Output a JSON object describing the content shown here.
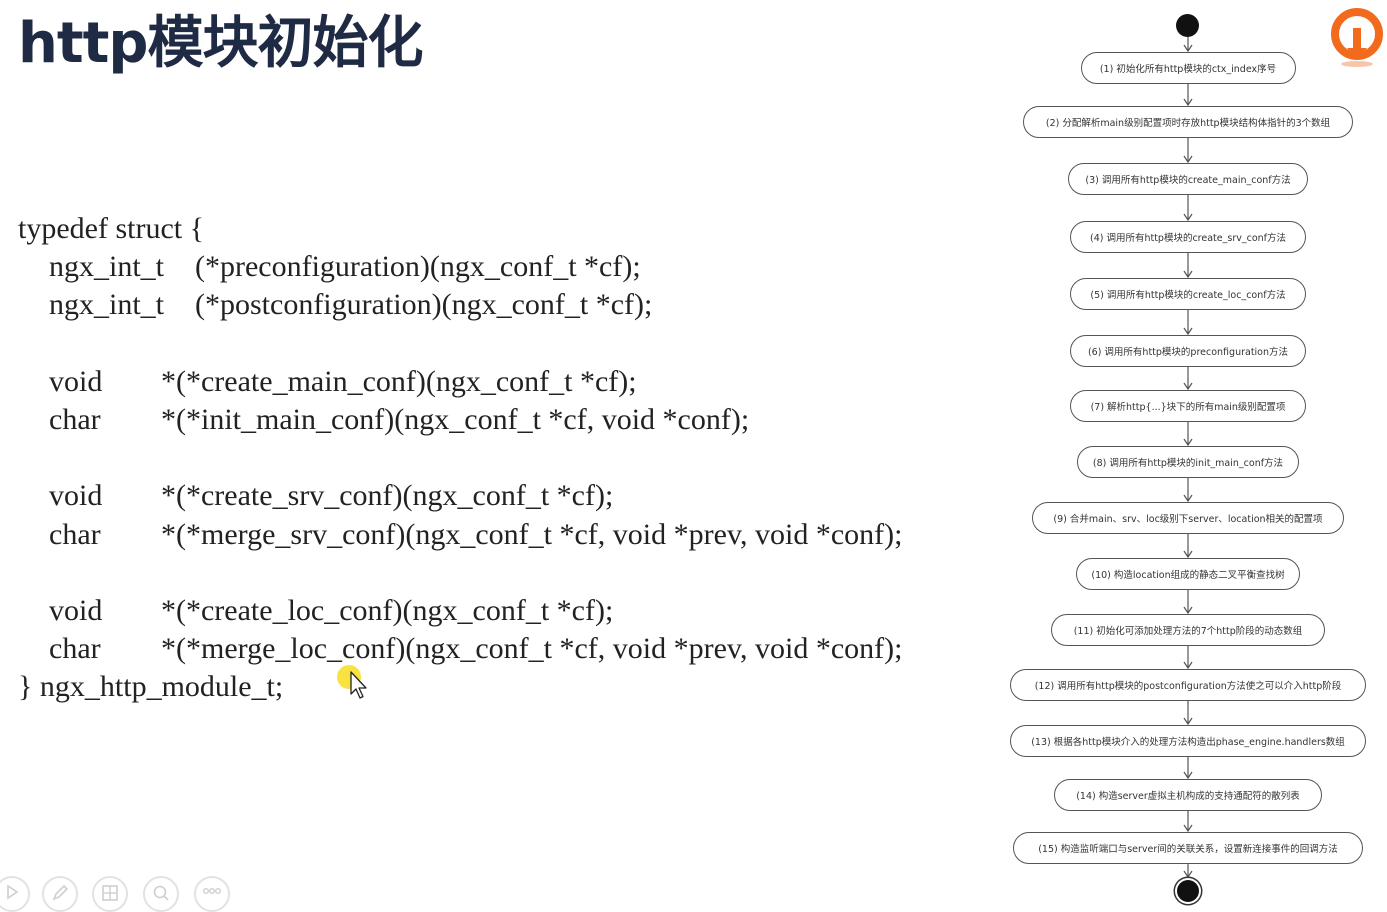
{
  "slide": {
    "title": "http模块初始化"
  },
  "code": {
    "open": "typedef struct {",
    "lines": [
      {
        "type": "ngx_int_t",
        "decl": "(*preconfiguration)(ngx_conf_t *cf);"
      },
      {
        "type": "ngx_int_t",
        "decl": "(*postconfiguration)(ngx_conf_t *cf);"
      },
      {
        "type": "void",
        "decl": "*(*create_main_conf)(ngx_conf_t *cf);"
      },
      {
        "type": "char",
        "decl": "*(*init_main_conf)(ngx_conf_t *cf, void *conf);"
      },
      {
        "type": "void",
        "decl": "*(*create_srv_conf)(ngx_conf_t *cf);"
      },
      {
        "type": "char",
        "decl": "*(*merge_srv_conf)(ngx_conf_t *cf, void *prev, void *conf);"
      },
      {
        "type": "void",
        "decl": "*(*create_loc_conf)(ngx_conf_t *cf);"
      },
      {
        "type": "char",
        "decl": "*(*merge_loc_conf)(ngx_conf_t *cf, void *prev, void *conf);"
      }
    ],
    "close": "} ngx_http_module_t;"
  },
  "flow": {
    "steps": [
      "(1) 初始化所有http模块的ctx_index序号",
      "(2) 分配解析main级别配置项时存放http模块结构体指针的3个数组",
      "(3) 调用所有http模块的create_main_conf方法",
      "(4) 调用所有http模块的create_srv_conf方法",
      "(5) 调用所有http模块的create_loc_conf方法",
      "(6) 调用所有http模块的preconfiguration方法",
      "(7) 解析http{...}块下的所有main级别配置项",
      "(8) 调用所有http模块的init_main_conf方法",
      "(9) 合并main、srv、loc级别下server、location相关的配置项",
      "(10) 构造location组成的静态二叉平衡查找树",
      "(11) 初始化可添加处理方法的7个http阶段的动态数组",
      "(12) 调用所有http模块的postconfiguration方法使之可以介入http阶段",
      "(13) 根据各http模块介入的处理方法构造出phase_engine.handlers数组",
      "(14) 构造server虚拟主机构成的支持通配符的散列表",
      "(15) 构造监听端口与server间的关联关系，设置新连接事件的回调方法"
    ]
  },
  "toolbar": {
    "icons": [
      "play-icon",
      "pen-icon",
      "layout-icon",
      "zoom-icon",
      "more-icon"
    ]
  },
  "colors": {
    "title": "#1f2a44",
    "code": "#222222",
    "logo_orange": "#f26b1d",
    "cursor_highlight": "#f5d800"
  }
}
